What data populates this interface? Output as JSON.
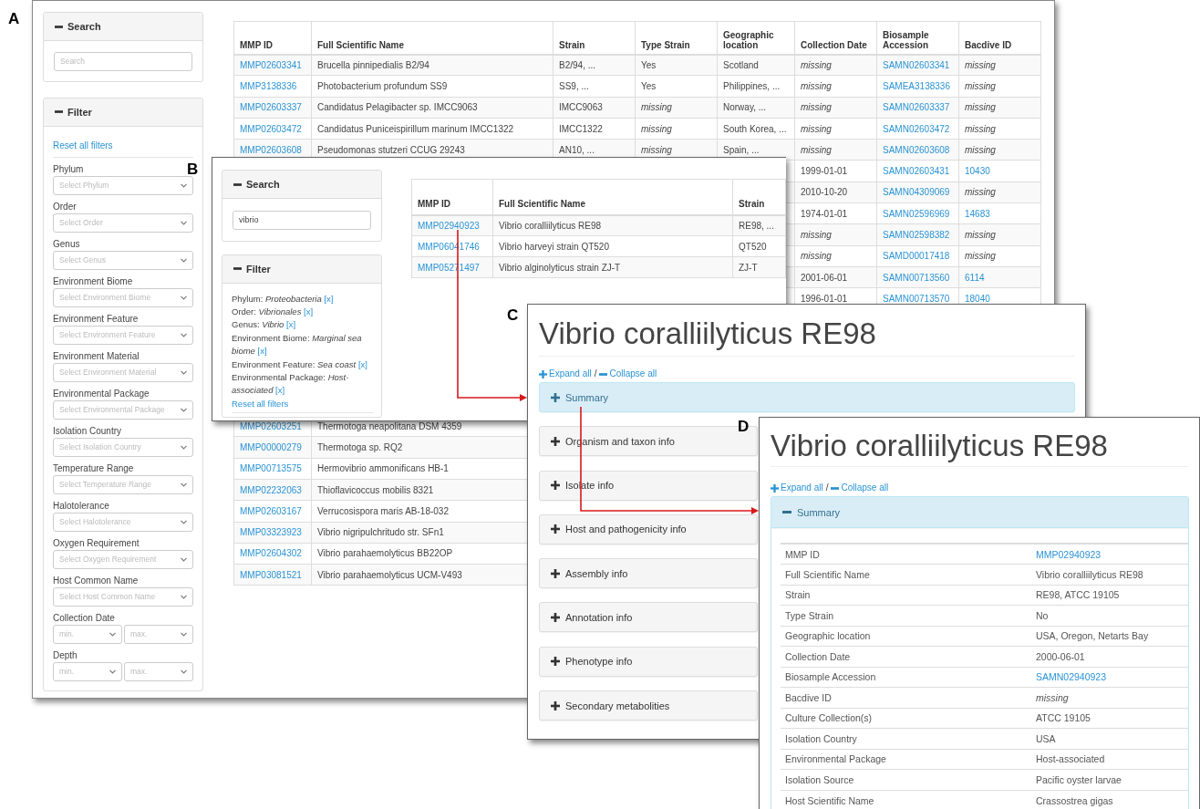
{
  "browse": {
    "label": "A",
    "search": {
      "title": "Search",
      "expanded": true,
      "placeholder": "Search"
    },
    "filter": {
      "title": "Filter",
      "expanded": true,
      "reset": "Reset all filters",
      "fields": [
        {
          "label": "Phylum",
          "selects": [
            "Select Phylum"
          ]
        },
        {
          "label": "Order",
          "selects": [
            "Select Order"
          ]
        },
        {
          "label": "Genus",
          "selects": [
            "Select Genus"
          ]
        },
        {
          "label": "Environment Biome",
          "selects": [
            "Select Environment Biome"
          ]
        },
        {
          "label": "Environment Feature",
          "selects": [
            "Select Environment Feature"
          ]
        },
        {
          "label": "Environment Material",
          "selects": [
            "Select Environment Material"
          ]
        },
        {
          "label": "Environmental Package",
          "selects": [
            "Select Environmental Package"
          ]
        },
        {
          "label": "Isolation Country",
          "selects": [
            "Select Isolation Country"
          ]
        },
        {
          "label": "Temperature Range",
          "selects": [
            "Select Temperature Range"
          ]
        },
        {
          "label": "Halotolerance",
          "selects": [
            "Select Halotolerance"
          ]
        },
        {
          "label": "Oxygen Requirement",
          "selects": [
            "Select Oxygen Requirement"
          ]
        },
        {
          "label": "Host Common Name",
          "selects": [
            "Select Host Common Name"
          ]
        },
        {
          "label": "Collection Date",
          "selects": [
            "min.",
            "max."
          ]
        },
        {
          "label": "Depth",
          "selects": [
            "min.",
            "max."
          ]
        }
      ]
    },
    "table": {
      "columns": [
        "MMP ID",
        "Full Scientific Name",
        "Strain",
        "Type Strain",
        "Geographic location",
        "Collection Date",
        "Biosample Accession",
        "Bacdive ID"
      ],
      "rows": [
        [
          {
            "text": "MMP02603341",
            "kind": "link"
          },
          {
            "text": "Brucella pinnipedialis B2/94",
            "kind": "text"
          },
          {
            "text": "B2/94, ...",
            "kind": "text"
          },
          {
            "text": "Yes",
            "kind": "text"
          },
          {
            "text": "Scotland",
            "kind": "text"
          },
          {
            "text": "missing",
            "kind": "missing"
          },
          {
            "text": "SAMN02603341",
            "kind": "link"
          },
          {
            "text": "missing",
            "kind": "missing"
          }
        ],
        [
          {
            "text": "MMP3138336",
            "kind": "link"
          },
          {
            "text": "Photobacterium profundum SS9",
            "kind": "text"
          },
          {
            "text": "SS9, ...",
            "kind": "text"
          },
          {
            "text": "Yes",
            "kind": "text"
          },
          {
            "text": "Philippines, ...",
            "kind": "text"
          },
          {
            "text": "missing",
            "kind": "missing"
          },
          {
            "text": "SAMEA3138336",
            "kind": "link"
          },
          {
            "text": "missing",
            "kind": "missing"
          }
        ],
        [
          {
            "text": "MMP02603337",
            "kind": "link"
          },
          {
            "text": "Candidatus Pelagibacter sp. IMCC9063",
            "kind": "text"
          },
          {
            "text": "IMCC9063",
            "kind": "text"
          },
          {
            "text": "missing",
            "kind": "missing"
          },
          {
            "text": "Norway, ...",
            "kind": "text"
          },
          {
            "text": "missing",
            "kind": "missing"
          },
          {
            "text": "SAMN02603337",
            "kind": "link"
          },
          {
            "text": "missing",
            "kind": "missing"
          }
        ],
        [
          {
            "text": "MMP02603472",
            "kind": "link"
          },
          {
            "text": "Candidatus Puniceispirillum marinum IMCC1322",
            "kind": "text"
          },
          {
            "text": "IMCC1322",
            "kind": "text"
          },
          {
            "text": "missing",
            "kind": "missing"
          },
          {
            "text": "South Korea, ...",
            "kind": "text"
          },
          {
            "text": "missing",
            "kind": "missing"
          },
          {
            "text": "SAMN02603472",
            "kind": "link"
          },
          {
            "text": "missing",
            "kind": "missing"
          }
        ],
        [
          {
            "text": "MMP02603608",
            "kind": "link"
          },
          {
            "text": "Pseudomonas stutzeri CCUG 29243",
            "kind": "text"
          },
          {
            "text": "AN10, ...",
            "kind": "text"
          },
          {
            "text": "missing",
            "kind": "missing"
          },
          {
            "text": "Spain, ...",
            "kind": "text"
          },
          {
            "text": "missing",
            "kind": "missing"
          },
          {
            "text": "SAMN02603608",
            "kind": "link"
          },
          {
            "text": "missing",
            "kind": "missing"
          }
        ]
      ],
      "rows_right_part": [
        [
          {
            "text": "1999-01-01",
            "kind": "text"
          },
          {
            "text": "SAMN02603431",
            "kind": "link"
          },
          {
            "text": "10430",
            "kind": "link"
          }
        ],
        [
          {
            "text": "2010-10-20",
            "kind": "text"
          },
          {
            "text": "SAMN04309069",
            "kind": "link"
          },
          {
            "text": "missing",
            "kind": "missing"
          }
        ],
        [
          {
            "text": "1974-01-01",
            "kind": "text"
          },
          {
            "text": "SAMN02596969",
            "kind": "link"
          },
          {
            "text": "14683",
            "kind": "link"
          }
        ],
        [
          {
            "text": "missing",
            "kind": "missing"
          },
          {
            "text": "SAMN02598382",
            "kind": "link"
          },
          {
            "text": "missing",
            "kind": "missing"
          }
        ],
        [
          {
            "text": "missing",
            "kind": "missing"
          },
          {
            "text": "SAMD00017418",
            "kind": "link"
          },
          {
            "text": "missing",
            "kind": "missing"
          }
        ],
        [
          {
            "text": "2001-06-01",
            "kind": "text"
          },
          {
            "text": "SAMN00713560",
            "kind": "link"
          },
          {
            "text": "6114",
            "kind": "link"
          }
        ],
        [
          {
            "text": "1996-01-01",
            "kind": "text"
          },
          {
            "text": "SAMN00713570",
            "kind": "link"
          },
          {
            "text": "18040",
            "kind": "link"
          }
        ]
      ],
      "rows_left_part": [
        [
          {
            "text": "MMP02603251",
            "kind": "link"
          },
          {
            "text": "Thermotoga neapolitana DSM 4359",
            "kind": "text"
          }
        ],
        [
          {
            "text": "MMP00000279",
            "kind": "link"
          },
          {
            "text": "Thermotoga sp. RQ2",
            "kind": "text"
          }
        ],
        [
          {
            "text": "MMP00713575",
            "kind": "link"
          },
          {
            "text": "Hermovibrio ammonificans HB-1",
            "kind": "text"
          }
        ],
        [
          {
            "text": "MMP02232063",
            "kind": "link"
          },
          {
            "text": "Thioflavicoccus mobilis 8321",
            "kind": "text"
          }
        ],
        [
          {
            "text": "MMP02603167",
            "kind": "link"
          },
          {
            "text": "Verrucosispora maris AB-18-032",
            "kind": "text"
          }
        ],
        [
          {
            "text": "MMP03323923",
            "kind": "link"
          },
          {
            "text": "Vibrio nigripulchritudo str. SFn1",
            "kind": "text"
          }
        ],
        [
          {
            "text": "MMP02604302",
            "kind": "link"
          },
          {
            "text": "Vibrio parahaemolyticus BB22OP",
            "kind": "text"
          }
        ],
        [
          {
            "text": "MMP03081521",
            "kind": "link"
          },
          {
            "text": "Vibrio parahaemolyticus UCM-V493",
            "kind": "text"
          }
        ]
      ]
    }
  },
  "search_results": {
    "label": "B",
    "search": {
      "title": "Search",
      "expanded": true,
      "value": "vibrio"
    },
    "filter": {
      "title": "Filter",
      "expanded": true,
      "reset": "Reset all filters",
      "active_filters": [
        {
          "field": "Phylum:",
          "value": "Proteobacteria",
          "remove": "[x]"
        },
        {
          "field": "Order:",
          "value": "Vibrionales",
          "remove": "[x]"
        },
        {
          "field": "Genus:",
          "value": "Vibrio",
          "remove": "[x]"
        },
        {
          "field": "Environment Biome:",
          "value": "Marginal sea biome",
          "remove": "[x]"
        },
        {
          "field": "Environment Feature:",
          "value": "Sea coast",
          "remove": "[x]"
        },
        {
          "field": "Environmental Package:",
          "value": "Host-associated",
          "remove": "[x]"
        }
      ]
    },
    "table": {
      "columns": [
        "MMP ID",
        "Full Scientific Name",
        "Strain"
      ],
      "rows": [
        [
          {
            "text": "MMP02940923",
            "kind": "link"
          },
          {
            "text": "Vibrio coralliilyticus RE98",
            "kind": "text"
          },
          {
            "text": "RE98, ...",
            "kind": "text"
          }
        ],
        [
          {
            "text": "MMP06041746",
            "kind": "link"
          },
          {
            "text": "Vibrio harveyi strain QT520",
            "kind": "text"
          },
          {
            "text": "QT520",
            "kind": "text"
          }
        ],
        [
          {
            "text": "MMP05271497",
            "kind": "link"
          },
          {
            "text": "Vibrio alginolyticus strain ZJ-T",
            "kind": "text"
          },
          {
            "text": "ZJ-T",
            "kind": "text"
          }
        ]
      ]
    }
  },
  "detail_pages": [
    {
      "label": "C",
      "title": "Vibrio coralliilyticus RE98",
      "expand_all": "Expand all",
      "separator": "/",
      "collapse_all": "Collapse all",
      "sections": [
        {
          "title": "Summary",
          "expanded": false,
          "highlighted": true
        },
        {
          "title": "Organism and taxon info",
          "expanded": false,
          "highlighted": false
        },
        {
          "title": "Isolate info",
          "expanded": false,
          "highlighted": false
        },
        {
          "title": "Host and pathogenicity info",
          "expanded": false,
          "highlighted": false
        },
        {
          "title": "Assembly info",
          "expanded": false,
          "highlighted": false
        },
        {
          "title": "Annotation info",
          "expanded": false,
          "highlighted": false
        },
        {
          "title": "Phenotype info",
          "expanded": false,
          "highlighted": false
        },
        {
          "title": "Secondary metabolities",
          "expanded": false,
          "highlighted": false
        }
      ]
    },
    {
      "label": "D",
      "title": "Vibrio coralliilyticus RE98",
      "expand_all": "Expand all",
      "separator": "/",
      "collapse_all": "Collapse all",
      "sections": [
        {
          "title": "Summary",
          "expanded": true,
          "highlighted": true,
          "fields": [
            {
              "label": "MMP ID",
              "value": "MMP02940923",
              "kind": "link"
            },
            {
              "label": "Full Scientific Name",
              "value": "Vibrio coralliilyticus RE98",
              "kind": "text"
            },
            {
              "label": "Strain",
              "value": "RE98, ATCC 19105",
              "kind": "text"
            },
            {
              "label": "Type Strain",
              "value": "No",
              "kind": "text"
            },
            {
              "label": "Geographic location",
              "value": "USA, Oregon, Netarts Bay",
              "kind": "text"
            },
            {
              "label": "Collection Date",
              "value": "2000-06-01",
              "kind": "text"
            },
            {
              "label": "Biosample Accession",
              "value": "SAMN02940923",
              "kind": "link"
            },
            {
              "label": "Bacdive ID",
              "value": "missing",
              "kind": "missing"
            },
            {
              "label": "Culture Collection(s)",
              "value": "ATCC 19105",
              "kind": "text"
            },
            {
              "label": "Isolation Country",
              "value": "USA",
              "kind": "text"
            },
            {
              "label": "Environmental Package",
              "value": "Host-associated",
              "kind": "text"
            },
            {
              "label": "Isolation Source",
              "value": "Pacific oyster larvae",
              "kind": "text"
            },
            {
              "label": "Host Scientific Name",
              "value": "Crassostrea gigas",
              "kind": "text"
            }
          ]
        }
      ]
    }
  ]
}
